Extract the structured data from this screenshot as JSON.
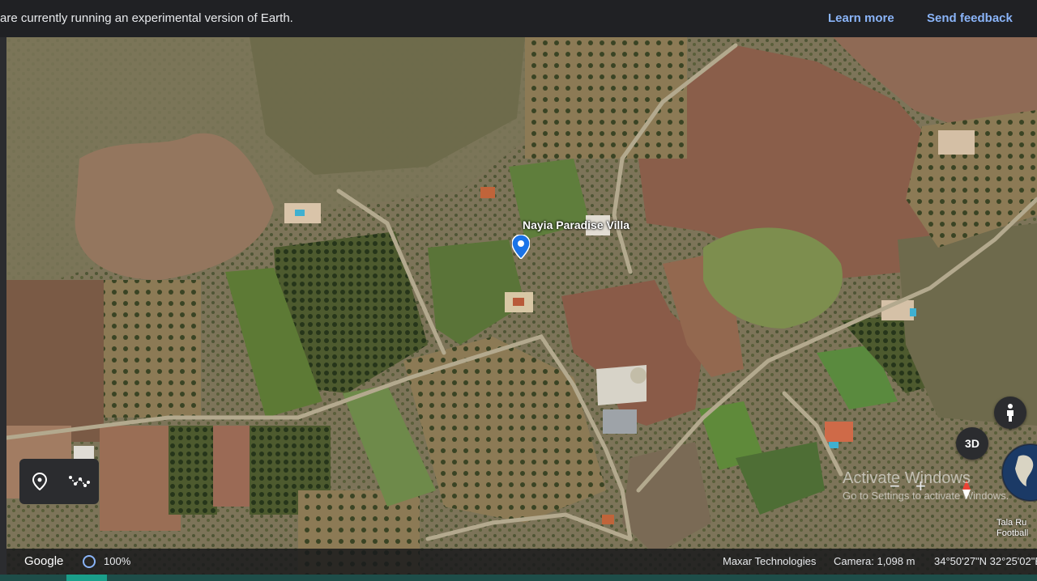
{
  "banner": {
    "message": "are currently running an experimental version of Earth.",
    "learn_more": "Learn more",
    "send_feedback": "Send feedback"
  },
  "map": {
    "place_label": "Nayia Paradise Villa",
    "edge_labels": [
      "Tala Ru",
      "Football"
    ]
  },
  "controls": {
    "btn_3d": "3D",
    "zoom_minus": "−",
    "zoom_plus": "+"
  },
  "watermark": {
    "line1": "Activate Windows",
    "line2": "Go to Settings to activate Windows."
  },
  "status": {
    "brand": "Google",
    "load_percent": "100%",
    "attribution": "Maxar Technologies",
    "camera": "Camera: 1,098 m",
    "coordinates": "34°50'27\"N 32°25'02\"E"
  },
  "icons": {
    "place": "location-pin-icon",
    "path": "path-measure-icon",
    "pegman": "pegman-icon",
    "compass": "compass-icon",
    "globe": "globe-icon"
  },
  "colors": {
    "accent_link": "#8ab4f8",
    "pin": "#1a73e8",
    "progress": "#1a9e8a"
  }
}
